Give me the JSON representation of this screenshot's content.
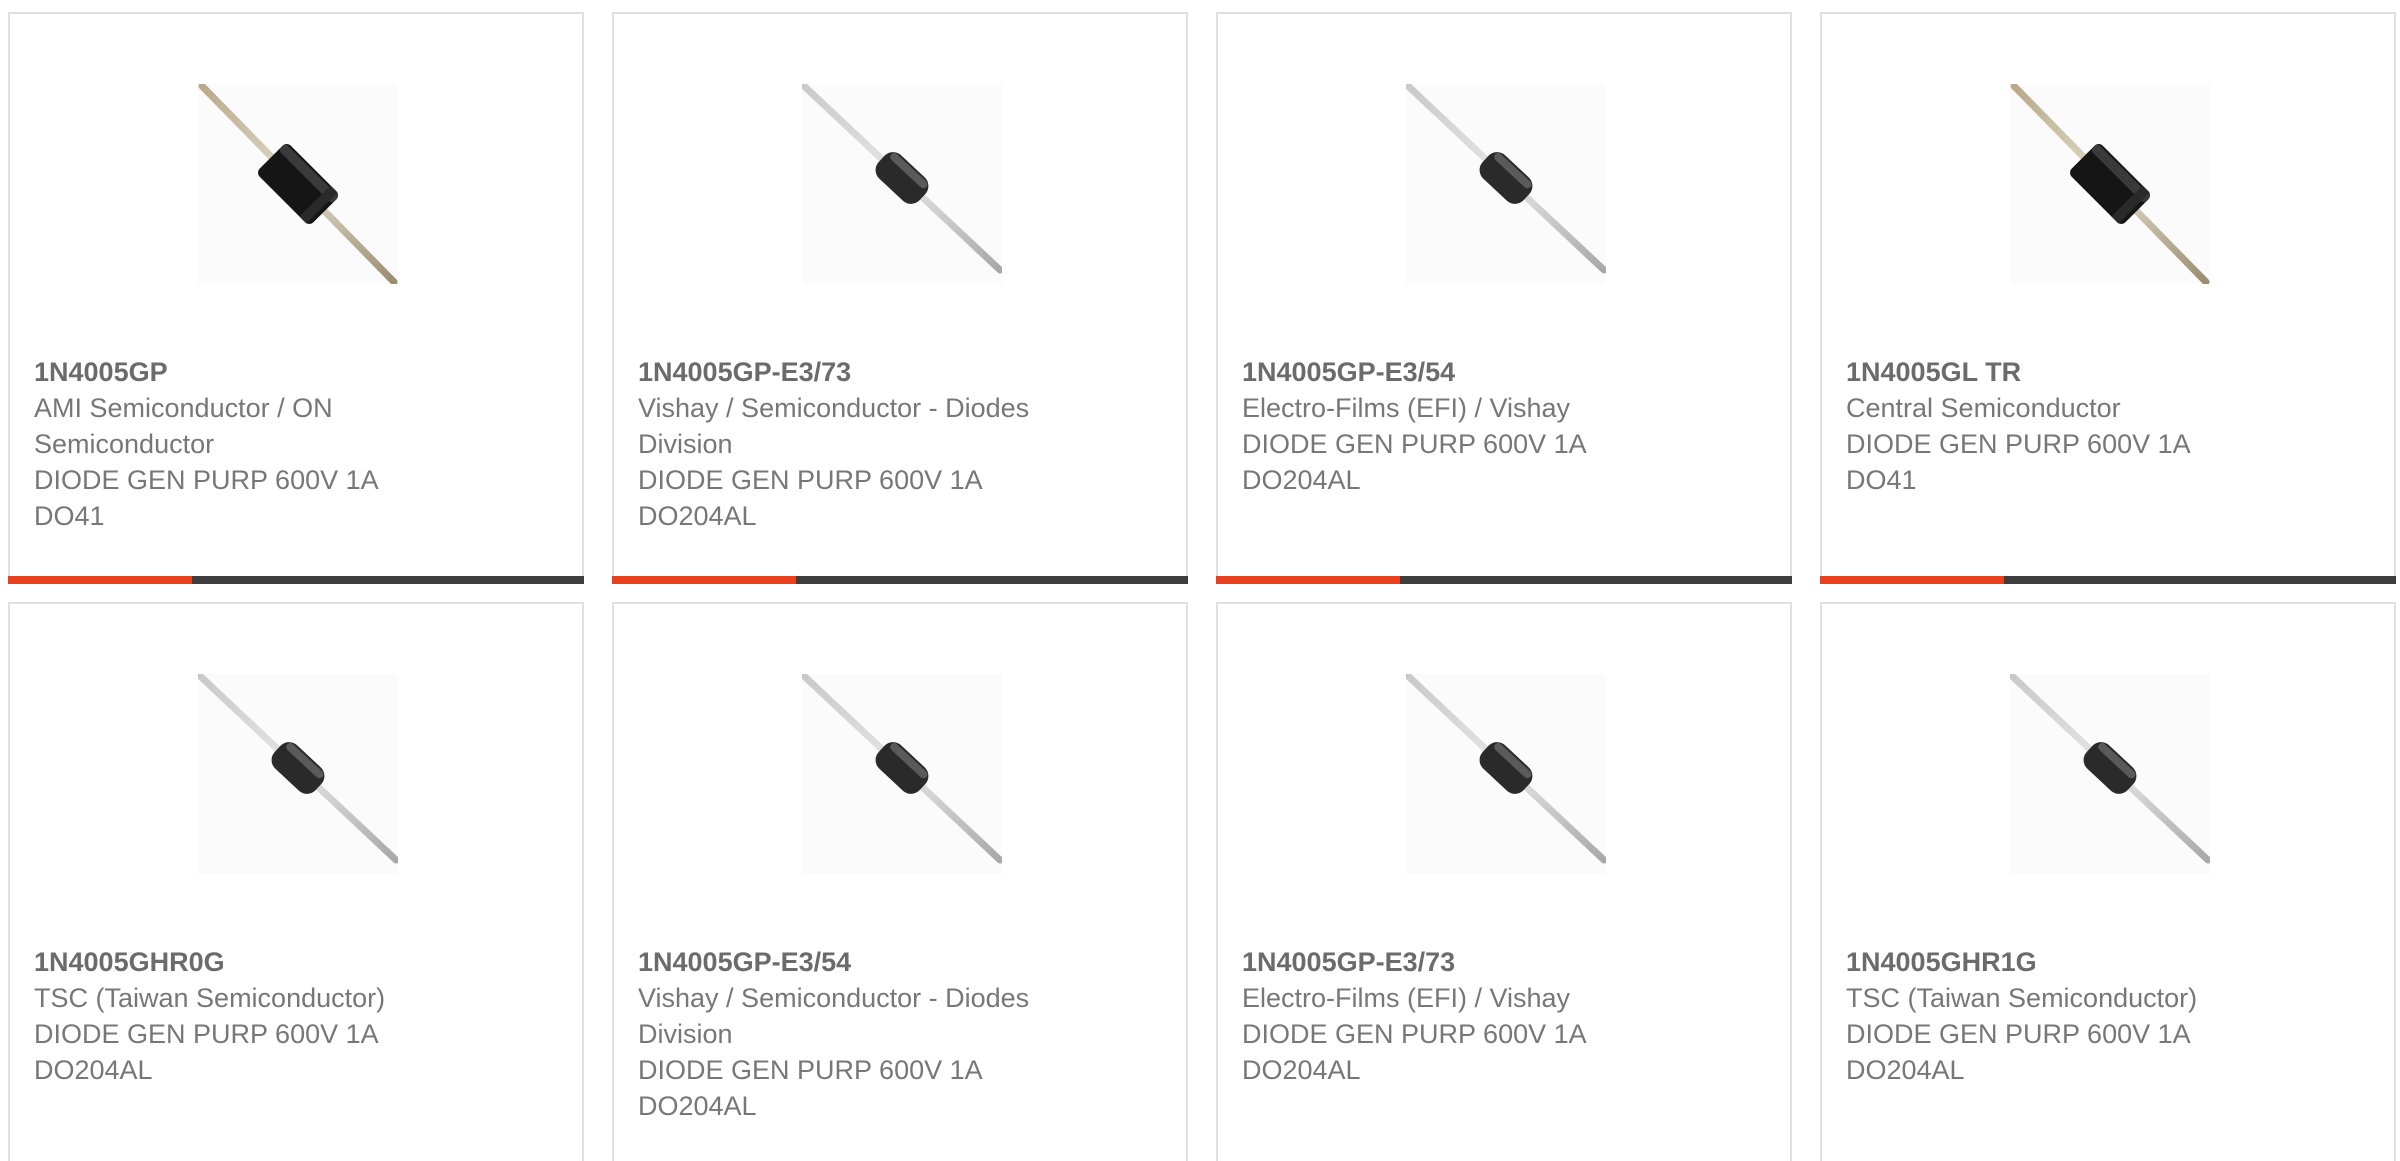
{
  "colors": {
    "accent": "#e8401c",
    "bar": "#3d3d3d",
    "text": "#777777",
    "border": "#e0e0e0"
  },
  "products": [
    {
      "part": "1N4005GP",
      "manufacturer_line1": "AMI Semiconductor / ON",
      "manufacturer_line2": "Semiconductor",
      "description": "DIODE GEN PURP 600V 1A",
      "package": "DO41",
      "image_icon": "diode-black-body-icon"
    },
    {
      "part": "1N4005GP-E3/73",
      "manufacturer_line1": "Vishay / Semiconductor - Diodes",
      "manufacturer_line2": "Division",
      "description": "DIODE GEN PURP 600V 1A",
      "package": "DO204AL",
      "image_icon": "diode-small-body-icon"
    },
    {
      "part": "1N4005GP-E3/54",
      "manufacturer_line1": "Electro-Films (EFI) / Vishay",
      "manufacturer_line2": "",
      "description": "DIODE GEN PURP 600V 1A",
      "package": "DO204AL",
      "image_icon": "diode-small-body-icon"
    },
    {
      "part": "1N4005GL TR",
      "manufacturer_line1": "Central Semiconductor",
      "manufacturer_line2": "",
      "description": "DIODE GEN PURP 600V 1A",
      "package": "DO41",
      "image_icon": "diode-black-body-icon"
    },
    {
      "part": "1N4005GHR0G",
      "manufacturer_line1": "TSC (Taiwan Semiconductor)",
      "manufacturer_line2": "",
      "description": "DIODE GEN PURP 600V 1A",
      "package": "DO204AL",
      "image_icon": "diode-small-body-icon"
    },
    {
      "part": "1N4005GP-E3/54",
      "manufacturer_line1": "Vishay / Semiconductor - Diodes",
      "manufacturer_line2": "Division",
      "description": "DIODE GEN PURP 600V 1A",
      "package": "DO204AL",
      "image_icon": "diode-small-body-icon"
    },
    {
      "part": "1N4005GP-E3/73",
      "manufacturer_line1": "Electro-Films (EFI) / Vishay",
      "manufacturer_line2": "",
      "description": "DIODE GEN PURP 600V 1A",
      "package": "DO204AL",
      "image_icon": "diode-small-body-icon"
    },
    {
      "part": "1N4005GHR1G",
      "manufacturer_line1": "TSC (Taiwan Semiconductor)",
      "manufacturer_line2": "",
      "description": "DIODE GEN PURP 600V 1A",
      "package": "DO204AL",
      "image_icon": "diode-small-body-icon"
    }
  ]
}
